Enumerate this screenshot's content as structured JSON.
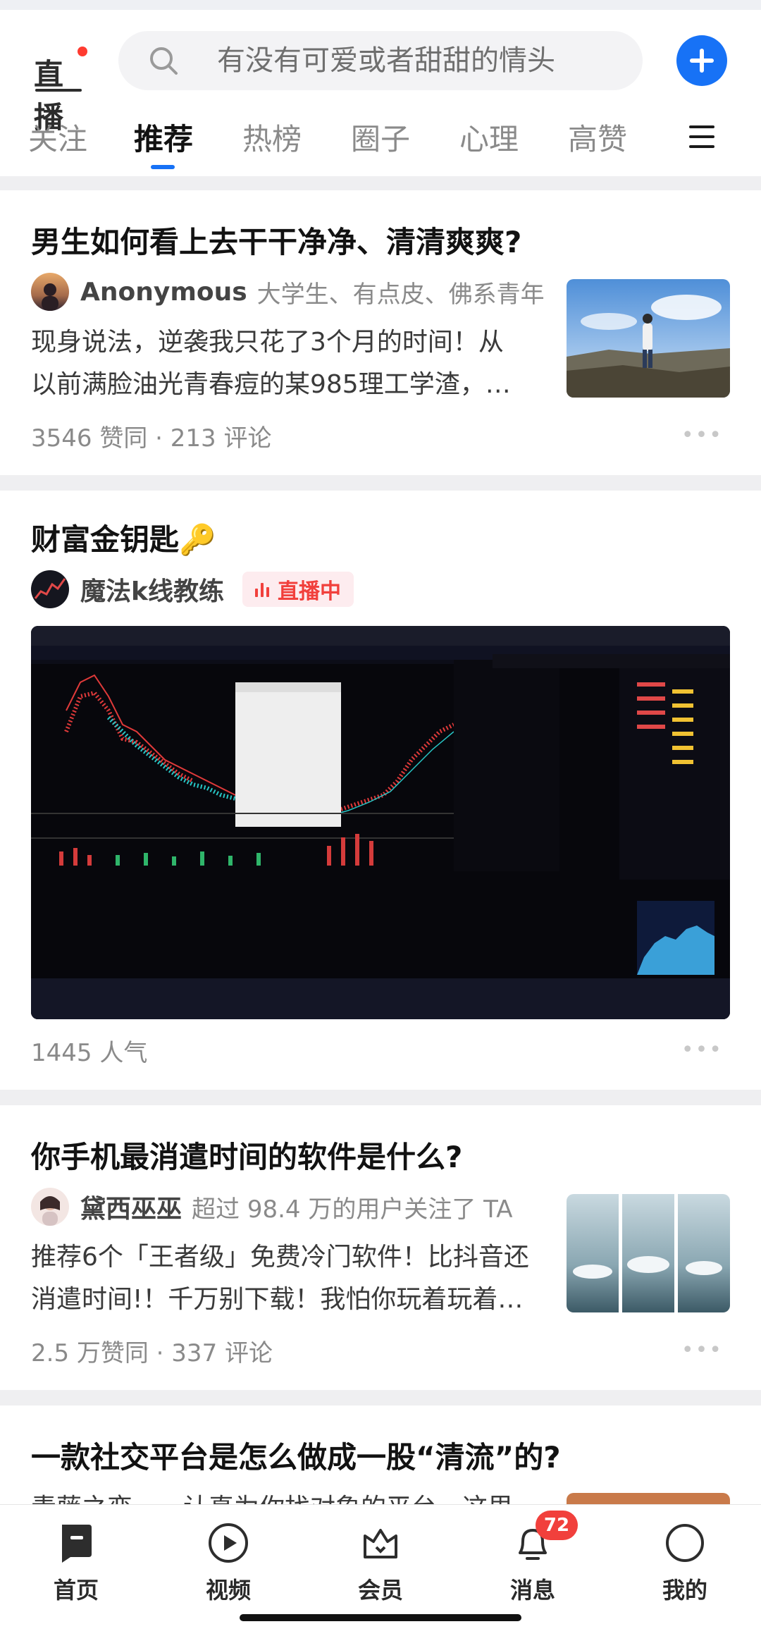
{
  "header": {
    "live_logo": "直播",
    "search_placeholder": "有没有可爱或者甜甜的情头",
    "tabs": [
      {
        "label": "关注"
      },
      {
        "label": "推荐"
      },
      {
        "label": "热榜"
      },
      {
        "label": "圈子"
      },
      {
        "label": "心理"
      },
      {
        "label": "高赞"
      }
    ],
    "active_tab": "推荐"
  },
  "feed": [
    {
      "title": "男生如何看上去干干净净、清清爽爽?",
      "author": "Anonymous",
      "author_desc": "大学生、有点皮、佛系青年",
      "excerpt_lines": [
        "现身说法，逆袭我只花了3个月的时间！从",
        "以前满脸油光青春痘的某985理工学渣，…"
      ],
      "meta": "3546 赞同 · 213 评论"
    },
    {
      "title": "财富金钥匙🔑",
      "author": "魔法k线教练",
      "live_badge": "直播中",
      "meta": "1445 人气"
    },
    {
      "title": "你手机最消遣时间的软件是什么?",
      "author": "黛西巫巫",
      "author_desc": "超过 98.4 万的用户关注了 TA",
      "excerpt_lines": [
        "推荐6个「王者级」免费冷门软件！比抖音还",
        "消遣时间!！千万别下载！我怕你玩着玩着…"
      ],
      "meta": "2.5 万赞同 · 337 评论"
    },
    {
      "title": "一款社交平台是怎么做成一股“清流”的?",
      "excerpt_partial": "青藤之恋——认真为你找对象的平台，这里"
    }
  ],
  "more_dots": "•••",
  "bottom_nav": [
    {
      "label": "首页",
      "icon": "home-icon"
    },
    {
      "label": "视频",
      "icon": "video-play-icon"
    },
    {
      "label": "会员",
      "icon": "crown-icon"
    },
    {
      "label": "消息",
      "icon": "bell-icon",
      "badge": "72"
    },
    {
      "label": "我的",
      "icon": "profile-icon"
    }
  ],
  "colors": {
    "accent": "#1772f6",
    "live_red": "#f1403c"
  }
}
